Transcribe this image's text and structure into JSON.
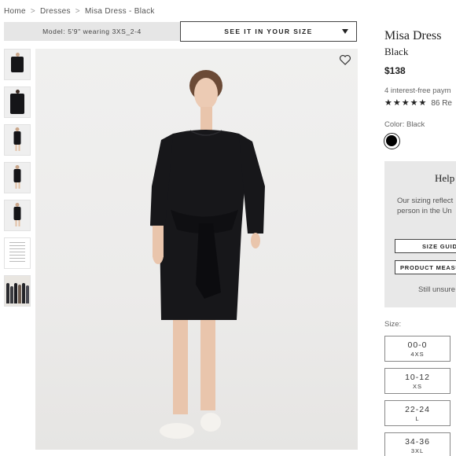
{
  "breadcrumb": {
    "items": [
      "Home",
      "Dresses",
      "Misa Dress - Black"
    ],
    "separator": ">"
  },
  "model_info": "Model: 5'9\" wearing 3XS_2-4",
  "see_in_size_button": "SEE IT IN YOUR SIZE",
  "product": {
    "title": "Misa Dress",
    "color_name": "Black",
    "price": "$138",
    "installments": "4 interest-free paym",
    "rating_stars": "★★★★★",
    "rating_value": 4.5,
    "reviews": "86 Re",
    "color_label": "Color: Black",
    "swatch_color": "#000000"
  },
  "help_box": {
    "title": "Help",
    "text_line1": "Our sizing reflect",
    "text_line2": "person in the Un",
    "size_guide_button": "SIZE GUID",
    "product_measurements_button": "PRODUCT MEASUR",
    "unsure_text": "Still unsure"
  },
  "sizes": {
    "label": "Size:",
    "options": [
      {
        "value": "00-0",
        "label": "4XS"
      },
      {
        "value": "10-12",
        "label": "XS"
      },
      {
        "value": "22-24",
        "label": "L"
      },
      {
        "value": "34-36",
        "label": "3XL"
      }
    ]
  },
  "icons": {
    "wishlist": "heart-outline-icon",
    "dropdown": "caret-down-icon"
  },
  "colors": {
    "dress": "#17171a",
    "background": "#efefee",
    "panel": "#e6e6e6"
  }
}
